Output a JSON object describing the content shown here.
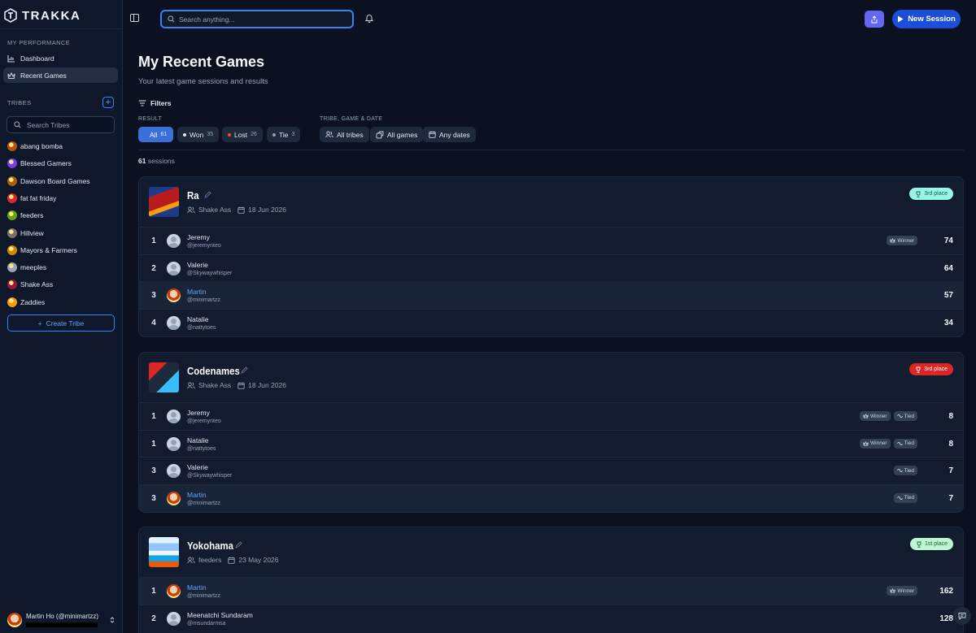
{
  "app": {
    "name": "TRAKKA"
  },
  "sidebar": {
    "performance_label": "MY PERFORMANCE",
    "nav": [
      {
        "label": "Dashboard",
        "icon": "chart-icon"
      },
      {
        "label": "Recent Games",
        "icon": "crown-icon"
      }
    ],
    "tribes_label": "TRIBES",
    "search_placeholder": "Search Tribes",
    "tribes": [
      "abang bomba",
      "Blessed Gamers",
      "Dawson Board Games",
      "fat fat friday",
      "feeders",
      "Hillview",
      "Mayors & Farmers",
      "meeples",
      "Shake Ass",
      "Zaddies"
    ],
    "tribe_colors": [
      "#b45309",
      "#7c3aed",
      "#a16207",
      "#dc2626",
      "#65a30d",
      "#78716c",
      "#ca8a04",
      "#94a3b8",
      "#9f1239",
      "#f59e0b"
    ],
    "create_tribe": "Create Tribe",
    "user": {
      "name": "Martin Ho (@minimartzz)"
    }
  },
  "topbar": {
    "search_placeholder": "Search anything...",
    "new_session": "New Session",
    "accent": "#1d4ed8"
  },
  "main": {
    "title": "My Recent Games",
    "subtitle": "Your latest game sessions and results",
    "filters_label": "Filters",
    "result_label": "RESULT",
    "tribe_label": "TRIBE, GAME & DATE",
    "result_chips": [
      {
        "label": "All",
        "count": "61"
      },
      {
        "label": "Won",
        "count": "35"
      },
      {
        "label": "Lost",
        "count": "26"
      },
      {
        "label": "Tie",
        "count": "3"
      }
    ],
    "scope_chips": [
      "All tribes",
      "All games",
      "Any dates"
    ],
    "sessions_count": "61",
    "sessions_label": "sessions"
  },
  "games": [
    {
      "name": "Ra",
      "tribe": "Shake Ass",
      "date": "18 Jun 2026",
      "badge": "3rd place",
      "badge_style": "teal",
      "players": [
        {
          "rank": "1",
          "name": "Jeremy",
          "handle": "@jeremynteo",
          "tags": [
            "Winner"
          ],
          "score": "74",
          "me": false
        },
        {
          "rank": "2",
          "name": "Valerie",
          "handle": "@Skywaywhisper",
          "tags": [],
          "score": "64",
          "me": false
        },
        {
          "rank": "3",
          "name": "Martin",
          "handle": "@minimartzz",
          "tags": [],
          "score": "57",
          "me": true
        },
        {
          "rank": "4",
          "name": "Natalie",
          "handle": "@nattytoes",
          "tags": [],
          "score": "34",
          "me": false
        }
      ]
    },
    {
      "name": "Codenames",
      "tribe": "Shake Ass",
      "date": "18 Jun 2026",
      "badge": "3rd place",
      "badge_style": "red",
      "players": [
        {
          "rank": "1",
          "name": "Jeremy",
          "handle": "@jeremynteo",
          "tags": [
            "Winner",
            "Tied"
          ],
          "score": "8",
          "me": false
        },
        {
          "rank": "1",
          "name": "Natalie",
          "handle": "@nattytoes",
          "tags": [
            "Winner",
            "Tied"
          ],
          "score": "8",
          "me": false
        },
        {
          "rank": "3",
          "name": "Valerie",
          "handle": "@Skywaywhisper",
          "tags": [
            "Tied"
          ],
          "score": "7",
          "me": false
        },
        {
          "rank": "3",
          "name": "Martin",
          "handle": "@minimartzz",
          "tags": [
            "Tied"
          ],
          "score": "7",
          "me": true
        }
      ]
    },
    {
      "name": "Yokohama",
      "tribe": "feeders",
      "date": "23 May 2026",
      "badge": "1st place",
      "badge_style": "green",
      "players": [
        {
          "rank": "1",
          "name": "Martin",
          "handle": "@minimartzz",
          "tags": [
            "Winner"
          ],
          "score": "162",
          "me": true
        },
        {
          "rank": "2",
          "name": "Meenatchi Sundaram",
          "handle": "@msundarmsa",
          "tags": [],
          "score": "128",
          "me": false
        }
      ]
    }
  ]
}
